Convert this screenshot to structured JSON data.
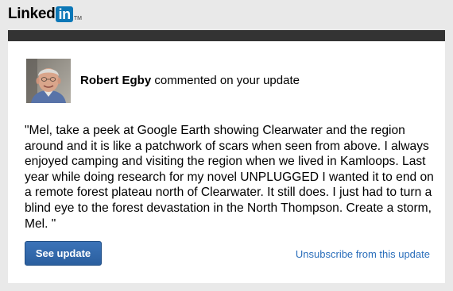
{
  "brand": {
    "logo_text": "Linked",
    "logo_in": "in",
    "logo_tm": "TM",
    "brand_color": "#0b77b7"
  },
  "notification": {
    "author": "Robert Egby",
    "action_text": " commented on your update",
    "comment": "\"Mel, take a peek at Google Earth showing Clearwater and the region around and it is like a patchwork of scars when seen from above. I always enjoyed camping and visiting the region when we lived in Kamloops. Last year while doing research for my novel UNPLUGGED I wanted it to end on a remote forest plateau north of Clearwater. It still does. I just had to turn a blind eye to the forest devastation in the North Thompson. Create a storm, Mel. \"",
    "avatar_icon": "profile-photo"
  },
  "actions": {
    "see_update_label": "See update",
    "unsubscribe_label": "Unsubscribe from this update",
    "button_color": "#2f67ab",
    "link_color": "#2a6ebb"
  },
  "colors": {
    "page_background": "#e9e9e9",
    "card_background": "#ffffff",
    "card_top_bar": "#333333"
  }
}
